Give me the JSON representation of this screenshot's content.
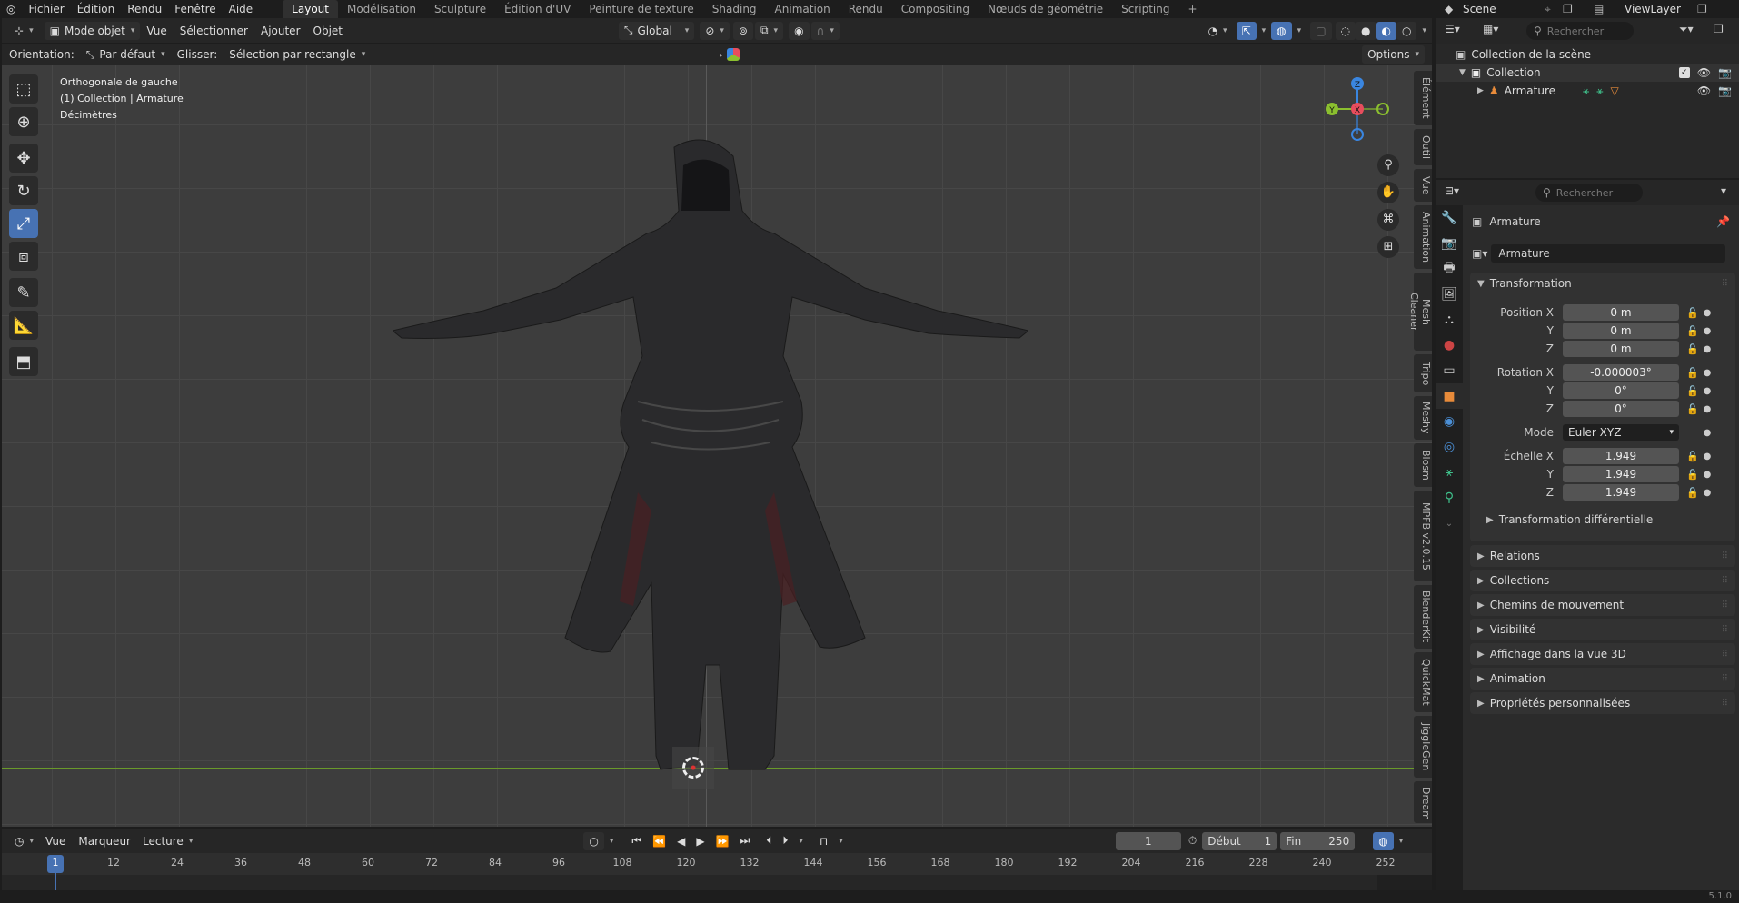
{
  "menubar": {
    "items": [
      "Fichier",
      "Édition",
      "Rendu",
      "Fenêtre",
      "Aide"
    ],
    "workspaces": [
      "Layout",
      "Modélisation",
      "Sculpture",
      "Édition d'UV",
      "Peinture de texture",
      "Shading",
      "Animation",
      "Rendu",
      "Compositing",
      "Nœuds de géométrie",
      "Scripting"
    ],
    "active_workspace": "Layout",
    "scene": "Scene",
    "view_layer": "ViewLayer"
  },
  "viewport_header": {
    "mode": "Mode objet",
    "menus": [
      "Vue",
      "Sélectionner",
      "Ajouter",
      "Objet"
    ],
    "transform_orientation": "Global",
    "options": "Options"
  },
  "tool_settings": {
    "orientation_label": "Orientation:",
    "orientation_value": "Par défaut",
    "drag_label": "Glisser:",
    "drag_value": "Sélection par rectangle"
  },
  "viewport": {
    "view_name": "Orthogonale de gauche",
    "collection_line": "(1) Collection | Armature",
    "units": "Décimètres",
    "gizmo": {
      "z": "Z",
      "y": "Y",
      "x": "X"
    },
    "side_tabs": [
      "Élément",
      "Outil",
      "Vue",
      "Animation",
      "Mesh Cleaner",
      "Tripo",
      "Meshy",
      "Blosm",
      "MPFB v2.0.15",
      "BlenderKit",
      "QuickMat",
      "JiggleGen",
      "Dream"
    ]
  },
  "timeline": {
    "menus": [
      "Vue",
      "Marqueur",
      "Lecture"
    ],
    "current_frame": "1",
    "start_label": "Début",
    "start": "1",
    "end_label": "Fin",
    "end": "250",
    "ticks": [
      "1",
      "12",
      "24",
      "36",
      "48",
      "60",
      "72",
      "84",
      "96",
      "108",
      "120",
      "132",
      "144",
      "156",
      "168",
      "180",
      "192",
      "204",
      "216",
      "228",
      "240",
      "252"
    ]
  },
  "outliner": {
    "search_placeholder": "Rechercher",
    "scene_collection": "Collection de la scène",
    "collection": "Collection",
    "object": "Armature"
  },
  "properties": {
    "search_placeholder": "Rechercher",
    "object_title": "Armature",
    "object_name": "Armature",
    "transform_title": "Transformation",
    "position_label": "Position X",
    "position": [
      "0 m",
      "0 m",
      "0 m"
    ],
    "rotation_label": "Rotation X",
    "rotation": [
      "-0.000003°",
      "0°",
      "0°"
    ],
    "mode_label": "Mode",
    "mode_value": "Euler XYZ",
    "scale_label": "Échelle X",
    "scale": [
      "1.949",
      "1.949",
      "1.949"
    ],
    "axis_y": "Y",
    "axis_z": "Z",
    "delta_transform": "Transformation différentielle",
    "panels": [
      "Relations",
      "Collections",
      "Chemins de mouvement",
      "Visibilité",
      "Affichage dans la vue 3D",
      "Animation",
      "Propriétés personnalisées"
    ]
  },
  "status_bar": {
    "version": "5.1.0"
  },
  "colors": {
    "accent": "#4772b3",
    "x_axis": "#e84d5d",
    "y_axis": "#8bbf2f",
    "z_axis": "#3a86e0",
    "ground_line": "#6a9a2a"
  }
}
